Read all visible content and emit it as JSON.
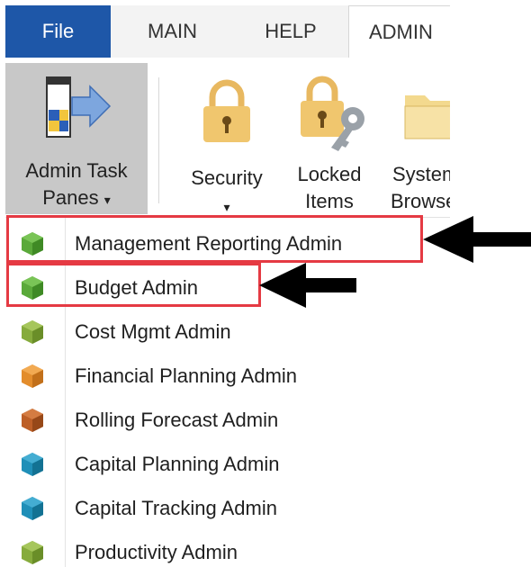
{
  "tabs": {
    "file": "File",
    "main": "MAIN",
    "help": "HELP",
    "admin": "ADMIN"
  },
  "ribbon": {
    "admin_task_panes": {
      "line1": "Admin Task",
      "line2": "Panes",
      "dropdown": "▾"
    },
    "security": {
      "line1": "Security",
      "dropdown": "▾"
    },
    "locked_items": {
      "line1": "Locked",
      "line2": "Items"
    },
    "system_browser": {
      "line1": "System",
      "line2": "Browser"
    }
  },
  "menu": {
    "items": [
      {
        "label": "Management Reporting Admin",
        "icon": "green-cube-icon",
        "color": "#4e9a2f"
      },
      {
        "label": "Budget Admin",
        "icon": "green-cube-icon",
        "color": "#4e9a2f"
      },
      {
        "label": "Cost Mgmt Admin",
        "icon": "olive-cube-icon",
        "color": "#7fa336"
      },
      {
        "label": "Financial Planning Admin",
        "icon": "orange-cube-icon",
        "color": "#e0892a"
      },
      {
        "label": "Rolling Forecast Admin",
        "icon": "rust-cube-icon",
        "color": "#b65a24"
      },
      {
        "label": "Capital Planning Admin",
        "icon": "teal-cube-icon",
        "color": "#1f8db5"
      },
      {
        "label": "Capital Tracking Admin",
        "icon": "teal-cube-icon",
        "color": "#1f8db5"
      },
      {
        "label": "Productivity Admin",
        "icon": "olive-cube-icon",
        "color": "#7fa336"
      }
    ]
  },
  "colors": {
    "file_tab": "#1e57a8",
    "highlight": "#e53a43",
    "lock": "#f0c66e"
  }
}
